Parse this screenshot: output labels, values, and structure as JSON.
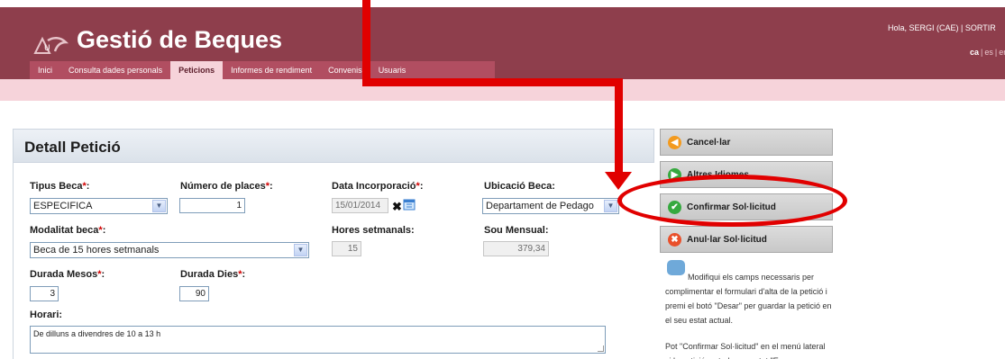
{
  "app": {
    "title": "Gestió de Beques",
    "user_greeting": "Hola, SERGI (CAE) | SORTIR",
    "languages": {
      "current": "ca",
      "others": [
        "es",
        "en"
      ]
    }
  },
  "tabs": [
    "Inici",
    "Consulta dades personals",
    "Peticions",
    "Informes de rendiment",
    "Convenis",
    "Usuaris"
  ],
  "active_tab": "Peticions",
  "panel": {
    "title": "Detall Petició"
  },
  "form": {
    "tipus_beca": {
      "label": "Tipus Beca",
      "value": "ESPECIFICA"
    },
    "numero_places": {
      "label": "Número de places",
      "value": "1"
    },
    "data_incorporacio": {
      "label": "Data Incorporació",
      "value": "15/01/2014"
    },
    "ubicacio_beca": {
      "label": "Ubicació Beca:",
      "value": "Departament de Pedago"
    },
    "modalitat_beca": {
      "label": "Modalitat beca",
      "value": "Beca de 15 hores setmanals"
    },
    "hores_setmanals": {
      "label": "Hores setmanals:",
      "value": "15"
    },
    "sou_mensual": {
      "label": "Sou Mensual:",
      "value": "379,34"
    },
    "durada_mesos": {
      "label": "Durada Mesos",
      "value": "3"
    },
    "durada_dies": {
      "label": "Durada Dies",
      "value": "90"
    },
    "horari": {
      "label": "Horari:",
      "value": "De dilluns a divendres de 10 a 13 h"
    }
  },
  "actions": {
    "cancel": "Cancel·lar",
    "other_languages": "Altres Idiomes",
    "confirm": "Confirmar Sol·licitud",
    "annul": "Anul·lar Sol·licitud"
  },
  "help": {
    "text": "Modifiqui els camps necessaris per complimentar el formulari d'alta de la petició i premi el botó \"Desar\" per guardar la petició en el seu estat actual.",
    "text2": "Pot \"Confirmar Sol·licitud\" en el menú lateral si la petició es troba en estat \"En"
  },
  "colors": {
    "header": "#8e3e4c",
    "tabbar": "#b14e61",
    "subbar": "#f6d3da",
    "annotation": "#e10000"
  }
}
